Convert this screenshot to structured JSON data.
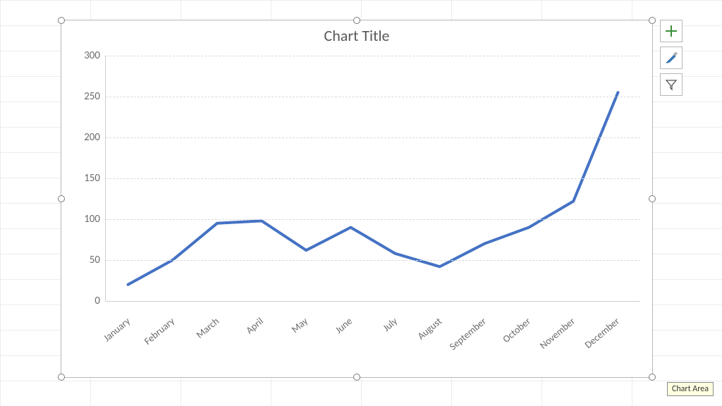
{
  "chart_data": {
    "type": "line",
    "title": "Chart Title",
    "categories": [
      "January",
      "February",
      "March",
      "April",
      "May",
      "June",
      "July",
      "August",
      "September",
      "October",
      "November",
      "December"
    ],
    "values": [
      20,
      50,
      95,
      98,
      62,
      90,
      58,
      42,
      70,
      90,
      122,
      255
    ],
    "y_ticks": [
      0,
      50,
      100,
      150,
      200,
      250,
      300
    ],
    "ylim": [
      0,
      300
    ],
    "xlabel": "",
    "ylabel": "",
    "line_color": "#4472C4"
  },
  "tooltip": {
    "text": "Chart Area"
  },
  "side_buttons": {
    "add": {
      "name": "chart-elements-button"
    },
    "style": {
      "name": "chart-styles-button"
    },
    "filter": {
      "name": "chart-filters-button"
    }
  }
}
